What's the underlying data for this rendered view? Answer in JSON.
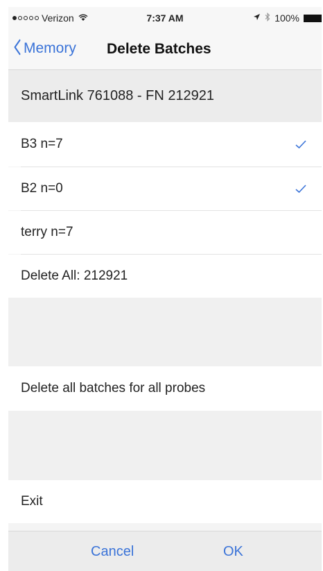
{
  "status_bar": {
    "carrier": "Verizon",
    "time": "7:37 AM",
    "battery": "100%"
  },
  "nav": {
    "back_label": "Memory",
    "title": "Delete Batches"
  },
  "device_header": "SmartLink 761088 - FN 212921",
  "batches": [
    {
      "label": "B3  n=7",
      "checked": true
    },
    {
      "label": "B2  n=0",
      "checked": true
    },
    {
      "label": "terry  n=7",
      "checked": false
    }
  ],
  "delete_all_label": "Delete All: 212921",
  "delete_all_probes_label": "Delete all batches for all probes",
  "exit_label": "Exit",
  "buttons": {
    "cancel": "Cancel",
    "ok": "OK"
  },
  "colors": {
    "accent": "#3a73d8",
    "annotation_arrow": "#c0161c"
  },
  "icons": {
    "back": "chevron-left-icon",
    "check": "checkmark-icon",
    "wifi": "wifi-icon",
    "location": "location-arrow-icon",
    "bluetooth": "bluetooth-icon",
    "battery": "battery-icon"
  }
}
